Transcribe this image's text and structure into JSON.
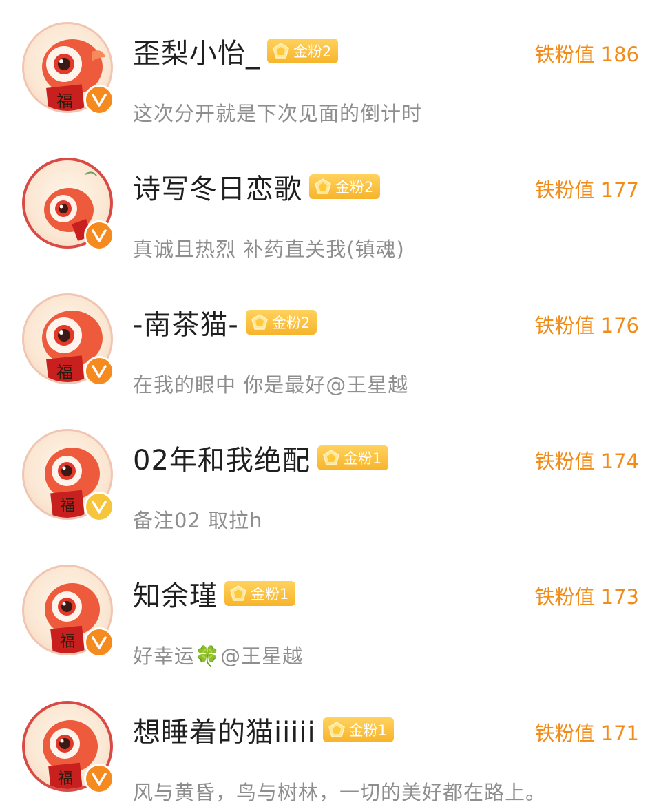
{
  "fans": [
    {
      "name": "歪梨小怡_",
      "fan_level": "金粉2",
      "bio": "这次分开就是下次见面的倒计时",
      "score": "铁粉值 186",
      "verified_color": "orange"
    },
    {
      "name": "诗写冬日恋歌",
      "fan_level": "金粉2",
      "bio": "真诚且热烈 补药直关我(镇魂)",
      "score": "铁粉值 177",
      "verified_color": "orange"
    },
    {
      "name": "-南茶猫-",
      "fan_level": "金粉2",
      "bio": "在我的眼中 你是最好@王星越",
      "score": "铁粉值 176",
      "verified_color": "orange"
    },
    {
      "name": "02年和我绝配",
      "fan_level": "金粉1",
      "bio": "备注02 取拉h",
      "score": "铁粉值 174",
      "verified_color": "gold"
    },
    {
      "name": "知余瑾",
      "fan_level": "金粉1",
      "bio": "好幸运🍀@王星越",
      "score": "铁粉值 173",
      "verified_color": "orange"
    },
    {
      "name": "想睡着的猫iiiii",
      "fan_level": "金粉1",
      "bio": "风与黄昏，鸟与树林，一切的美好都在路上。",
      "score": "铁粉值 171",
      "verified_color": "orange"
    }
  ],
  "avatar_text": "福",
  "colors": {
    "accent_orange": "#f28c18",
    "badge_gold": "#f7b42c",
    "verified_orange": "#f58a1f",
    "verified_gold": "#f6c53b"
  },
  "icons": [
    "avatar-mascot",
    "verified-v-icon",
    "gold-gem-icon"
  ]
}
